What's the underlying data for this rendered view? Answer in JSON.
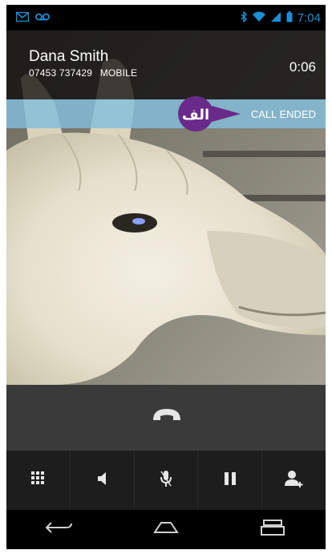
{
  "status_bar": {
    "time": "7:04",
    "icons": [
      "gmail-icon",
      "voicemail-icon",
      "bluetooth-icon",
      "wifi-icon",
      "signal-icon",
      "battery-icon"
    ]
  },
  "caller": {
    "name": "Dana Smith",
    "number": "07453 737429",
    "label": "MOBILE",
    "duration": "0:06"
  },
  "call_status": "CALL ENDED",
  "badge": {
    "text": "الف",
    "color": "#6a2a8a"
  },
  "controls": [
    "dialpad-icon",
    "speaker-icon",
    "mute-icon",
    "hold-icon",
    "add-call-icon"
  ],
  "nav": [
    "back-icon",
    "home-icon",
    "recents-icon"
  ],
  "colors": {
    "accent": "#1c8fd6",
    "status_bar_bg": "#82bedc",
    "end_bar_bg": "#3a3a3a",
    "controls_bg": "#1d1d1d"
  }
}
